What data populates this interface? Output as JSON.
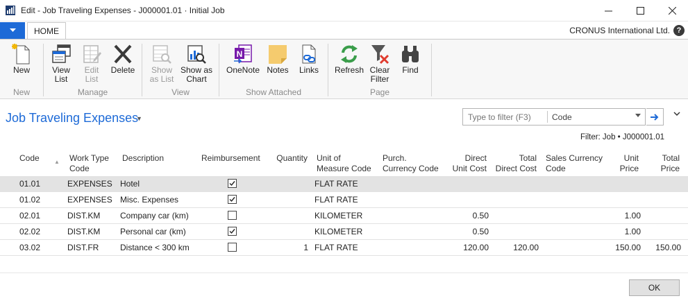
{
  "window": {
    "title": "Edit - Job Traveling Expenses - J000001.01 · Initial Job",
    "app_icon": "dynamics-nav-icon"
  },
  "ribbon_tabs": {
    "home": "HOME"
  },
  "company": "CRONUS International Ltd.",
  "help": "?",
  "ribbon": {
    "groups": [
      {
        "label": "New",
        "buttons": [
          {
            "label": "New",
            "icon": "new-document-icon",
            "enabled": true
          }
        ]
      },
      {
        "label": "Manage",
        "buttons": [
          {
            "label": "View\nList",
            "icon": "view-list-icon",
            "enabled": true
          },
          {
            "label": "Edit\nList",
            "icon": "edit-list-icon",
            "enabled": false
          },
          {
            "label": "Delete",
            "icon": "delete-icon",
            "enabled": true
          }
        ]
      },
      {
        "label": "View",
        "buttons": [
          {
            "label": "Show\nas List",
            "icon": "show-as-list-icon",
            "enabled": false
          },
          {
            "label": "Show as\nChart",
            "icon": "show-as-chart-icon",
            "enabled": true
          }
        ]
      },
      {
        "label": "Show Attached",
        "buttons": [
          {
            "label": "OneNote",
            "icon": "onenote-icon",
            "enabled": true
          },
          {
            "label": "Notes",
            "icon": "notes-icon",
            "enabled": true
          },
          {
            "label": "Links",
            "icon": "links-icon",
            "enabled": true
          }
        ]
      },
      {
        "label": "Page",
        "buttons": [
          {
            "label": "Refresh",
            "icon": "refresh-icon",
            "enabled": true
          },
          {
            "label": "Clear\nFilter",
            "icon": "clear-filter-icon",
            "enabled": true
          },
          {
            "label": "Find",
            "icon": "find-binoculars-icon",
            "enabled": true
          }
        ]
      }
    ]
  },
  "page": {
    "title": "Job Traveling Expenses",
    "filter_placeholder": "Type to filter (F3)",
    "filter_field": "Code",
    "filter_status": "Filter: Job • J000001.01"
  },
  "columns": [
    "Code",
    "Work Type\nCode",
    "Description",
    "Reimbursement",
    "Quantity",
    "Unit of\nMeasure Code",
    "Purch.\nCurrency Code",
    "Direct\nUnit Cost",
    "Total\nDirect Cost",
    "Sales Currency\nCode",
    "Unit\nPrice",
    "Total\nPrice"
  ],
  "rows": [
    {
      "code": "01.01",
      "work_type": "EXPENSES",
      "description": "Hotel",
      "reimbursement": true,
      "quantity": "",
      "uom": "FLAT RATE",
      "purch_currency": "",
      "direct_unit_cost": "",
      "total_direct_cost": "",
      "sales_currency": "",
      "unit_price": "",
      "total_price": ""
    },
    {
      "code": "01.02",
      "work_type": "EXPENSES",
      "description": "Misc. Expenses",
      "reimbursement": true,
      "quantity": "",
      "uom": "FLAT RATE",
      "purch_currency": "",
      "direct_unit_cost": "",
      "total_direct_cost": "",
      "sales_currency": "",
      "unit_price": "",
      "total_price": ""
    },
    {
      "code": "02.01",
      "work_type": "DIST.KM",
      "description": "Company car (km)",
      "reimbursement": false,
      "quantity": "",
      "uom": "KILOMETER",
      "purch_currency": "",
      "direct_unit_cost": "0.50",
      "total_direct_cost": "",
      "sales_currency": "",
      "unit_price": "1.00",
      "total_price": ""
    },
    {
      "code": "02.02",
      "work_type": "DIST.KM",
      "description": "Personal car (km)",
      "reimbursement": true,
      "quantity": "",
      "uom": "KILOMETER",
      "purch_currency": "",
      "direct_unit_cost": "0.50",
      "total_direct_cost": "",
      "sales_currency": "",
      "unit_price": "1.00",
      "total_price": ""
    },
    {
      "code": "03.02",
      "work_type": "DIST.FR",
      "description": "Distance < 300 km",
      "reimbursement": false,
      "quantity": "1",
      "uom": "FLAT RATE",
      "purch_currency": "",
      "direct_unit_cost": "120.00",
      "total_direct_cost": "120.00",
      "sales_currency": "",
      "unit_price": "150.00",
      "total_price": "150.00"
    }
  ],
  "ok_label": "OK",
  "colors": {
    "accent": "#1d6ad7",
    "selected_row": "#e3e3e3"
  }
}
